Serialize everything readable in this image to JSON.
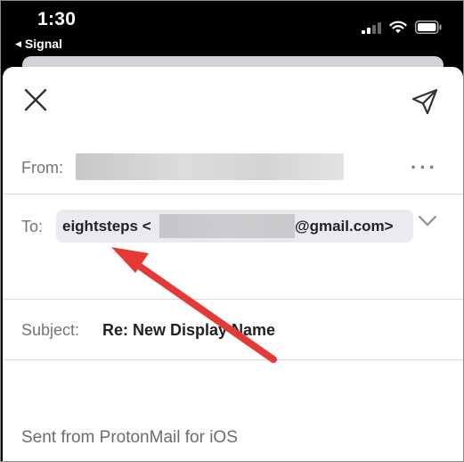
{
  "status_bar": {
    "time": "1:30",
    "back_app": "Signal",
    "back_icon": "back-triangle-icon",
    "signal_icon": "cellular-signal-icon",
    "wifi_icon": "wifi-icon",
    "battery_icon": "battery-icon"
  },
  "compose": {
    "close_icon": "close-icon",
    "send_icon": "send-icon",
    "from_label": "From:",
    "more_label": "···",
    "to_label": "To:",
    "recipient_name": "eightsteps <",
    "recipient_email_suffix": "@gmail.com>",
    "expand_icon": "chevron-down-icon",
    "subject_label": "Subject:",
    "subject_value": "Re: New Display Name",
    "signature": "Sent from ProtonMail for iOS"
  },
  "colors": {
    "annotation_arrow": "#e53935",
    "label_gray": "#73737a",
    "chip_bg": "#ebebef"
  }
}
